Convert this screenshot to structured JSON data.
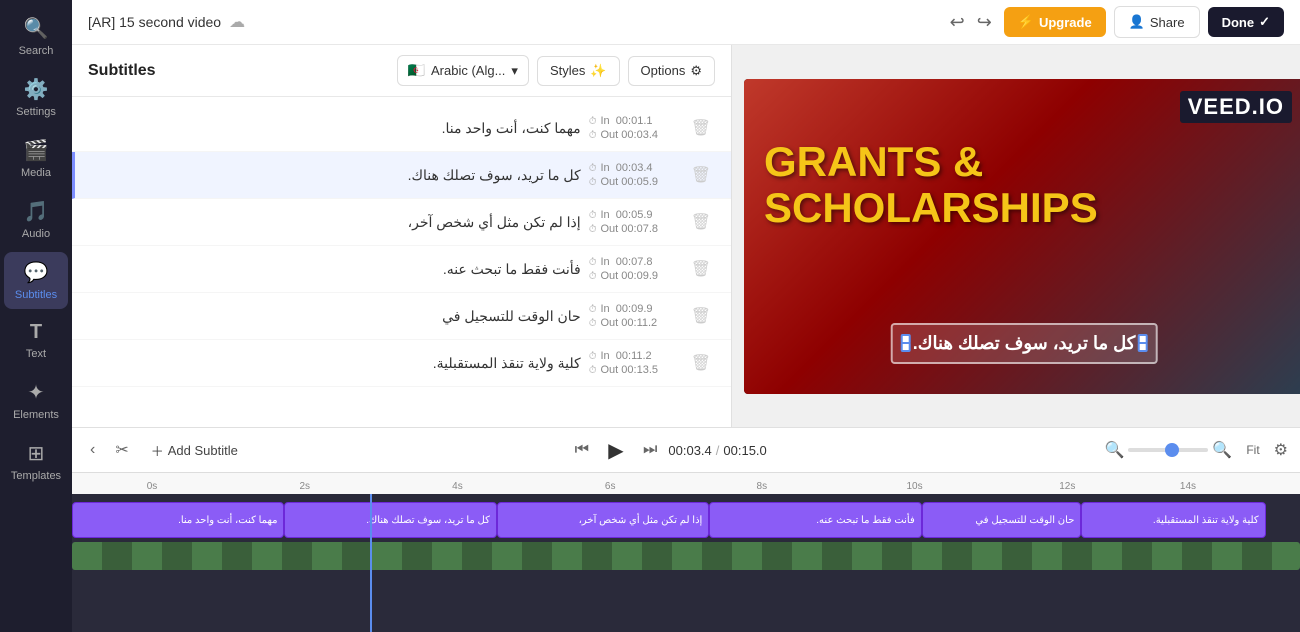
{
  "sidebar": {
    "items": [
      {
        "id": "search",
        "label": "Search",
        "icon": "🔍",
        "active": false
      },
      {
        "id": "settings",
        "label": "Settings",
        "icon": "⚙️",
        "active": false
      },
      {
        "id": "media",
        "label": "Media",
        "icon": "🎬",
        "active": false
      },
      {
        "id": "audio",
        "label": "Audio",
        "icon": "🎵",
        "active": false
      },
      {
        "id": "subtitles",
        "label": "Subtitles",
        "icon": "💬",
        "active": true
      },
      {
        "id": "text",
        "label": "Text",
        "icon": "T",
        "active": false
      },
      {
        "id": "elements",
        "label": "Elements",
        "icon": "✦",
        "active": false
      },
      {
        "id": "templates",
        "label": "Templates",
        "icon": "⊞",
        "active": false
      }
    ]
  },
  "subtitles_panel": {
    "title": "Subtitles",
    "language_label": "Arabic (Alg...",
    "styles_label": "Styles",
    "options_label": "Options",
    "items": [
      {
        "text": "مهما كنت، أنت واحد منا.",
        "time_in": "00:01.1",
        "time_out": "00:03.4",
        "selected": false
      },
      {
        "text": "كل ما تريد، سوف تصلك هناك.",
        "time_in": "00:03.4",
        "time_out": "00:05.9",
        "selected": true
      },
      {
        "text": "إذا لم تكن مثل أي شخص آخر،",
        "time_in": "00:05.9",
        "time_out": "00:07.8",
        "selected": false
      },
      {
        "text": "فأنت فقط ما تبحث عنه.",
        "time_in": "00:07.8",
        "time_out": "00:09.9",
        "selected": false
      },
      {
        "text": "حان الوقت للتسجيل في",
        "time_in": "00:09.9",
        "time_out": "00:11.2",
        "selected": false
      },
      {
        "text": "كلية ولاية تنقذ المستقبلية.",
        "time_in": "00:11.2",
        "time_out": "00:13.5",
        "selected": false
      }
    ]
  },
  "video": {
    "title": "[AR] 15 second video",
    "veed_logo": "VEED.IO",
    "main_text_line1": "GRANTS &",
    "main_text_line2": "SCHOLARSHIPS",
    "subtitle_overlay": "كل ما تريد، سوف تصلك هناك.",
    "current_time": "00:03.4",
    "total_time": "00:15.0"
  },
  "toolbar": {
    "upgrade_label": "Upgrade",
    "share_label": "Share",
    "done_label": "Done",
    "add_subtitle_label": "Add Subtitle",
    "fit_label": "Fit"
  },
  "timeline": {
    "clips": [
      {
        "text": "مهما كنت، أنت واحد منا.",
        "left_pct": 0,
        "width_pct": 17.3
      },
      {
        "text": "كل ما تريد، سوف تصلك هناك.",
        "left_pct": 17.3,
        "width_pct": 17.3
      },
      {
        "text": "إذا لم تكن مثل أي شخص آخر،",
        "left_pct": 34.6,
        "width_pct": 17.3
      },
      {
        "text": "فأنت فقط ما تبحث عنه.",
        "left_pct": 51.9,
        "width_pct": 17.3
      },
      {
        "text": "حان الوقت للتسجيل في",
        "left_pct": 69.2,
        "width_pct": 13.0
      },
      {
        "text": "كلية ولاية تنقذ المستقبلية.",
        "left_pct": 82.2,
        "width_pct": 15.0
      }
    ],
    "ruler_marks": [
      {
        "label": "0s",
        "left_pct": 0
      },
      {
        "label": "2s",
        "left_pct": 14.3
      },
      {
        "label": "4s",
        "left_pct": 28.6
      },
      {
        "label": "6s",
        "left_pct": 42.9
      },
      {
        "label": "8s",
        "left_pct": 57.1
      },
      {
        "label": "10s",
        "left_pct": 71.4
      },
      {
        "label": "12s",
        "left_pct": 85.7
      },
      {
        "label": "14s",
        "left_pct": 97.0
      }
    ],
    "playhead_left_pct": 24.3
  }
}
